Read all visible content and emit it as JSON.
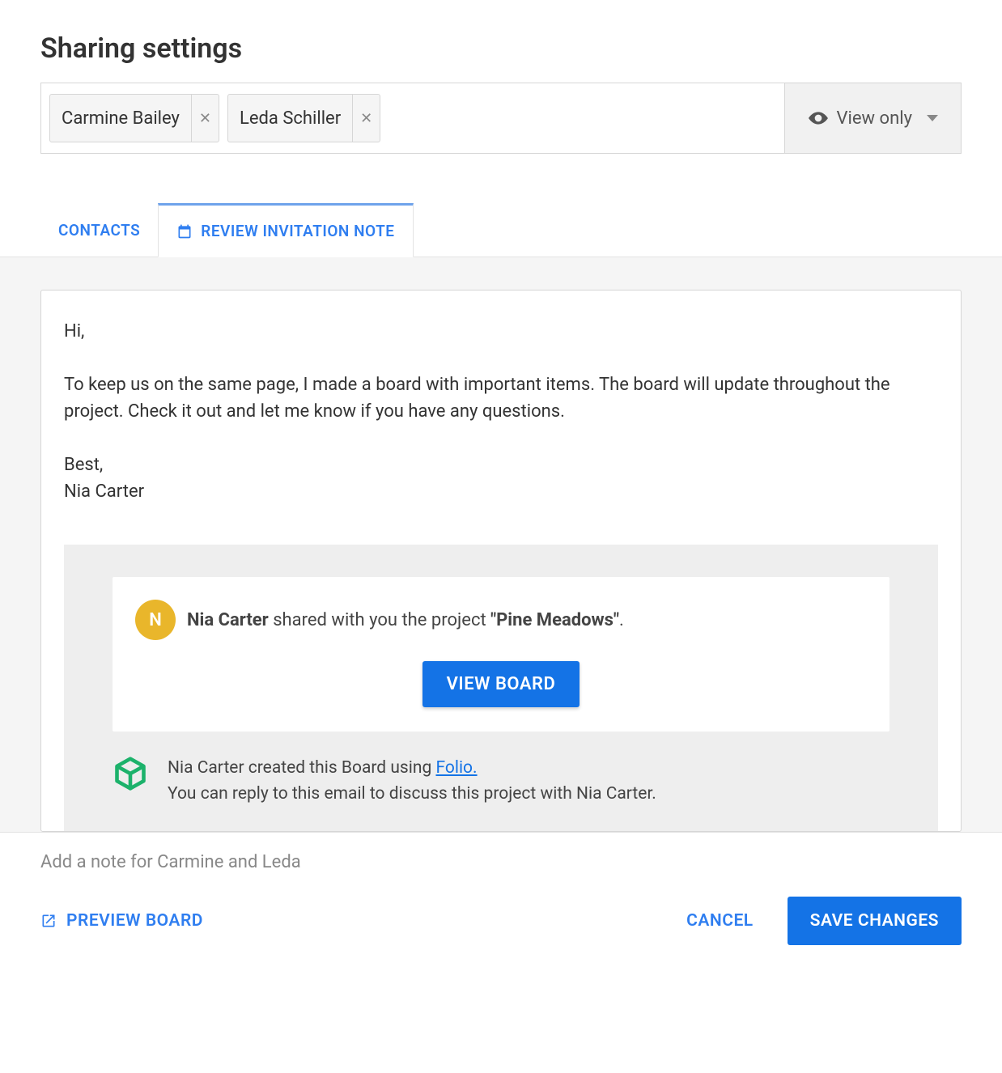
{
  "title": "Sharing settings",
  "chips": [
    {
      "name": "Carmine Bailey"
    },
    {
      "name": "Leda Schiller"
    }
  ],
  "permission": {
    "label": "View only"
  },
  "tabs": {
    "contacts": "CONTACTS",
    "review": "REVIEW INVITATION NOTE"
  },
  "note": {
    "body": "Hi,\n\nTo keep us on the same page, I made a board with important items. The board will update throughout the project. Check it out and let me know if you have any questions.\n\nBest,\nNia Carter"
  },
  "preview": {
    "avatar_initial": "N",
    "sharer": "Nia Carter",
    "shared_mid": " shared with you the project ",
    "project_quoted": "\"Pine Meadows\"",
    "trailing_period": ".",
    "view_board": "VIEW BOARD",
    "footer_created_prefix": "Nia Carter created this Board using ",
    "folio_link": "Folio.",
    "footer_reply": "You can reply to this email to discuss this project with Nia Carter."
  },
  "bottom": {
    "caption": "Add a note for Carmine and Leda",
    "preview_board": "PREVIEW BOARD",
    "cancel": "CANCEL",
    "save": "SAVE CHANGES"
  }
}
